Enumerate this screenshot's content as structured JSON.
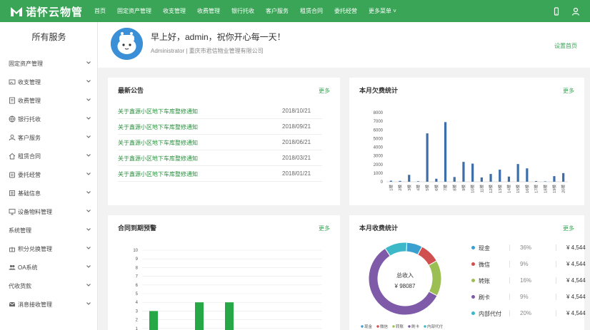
{
  "app": {
    "logo_text": "诺怀云物管"
  },
  "topnav": [
    "首页",
    "固定资产管理",
    "收支管理",
    "收费管理",
    "银行托收",
    "客户服务",
    "租赁合同",
    "委托经营",
    "更多菜单"
  ],
  "sidebar": {
    "title": "所有服务",
    "items": [
      {
        "label": "固定资产管理",
        "icon": "none"
      },
      {
        "label": "收支管理",
        "icon": "image-icon"
      },
      {
        "label": "收费管理",
        "icon": "invoice-icon"
      },
      {
        "label": "银行托收",
        "icon": "globe-icon"
      },
      {
        "label": "客户服务",
        "icon": "user-icon"
      },
      {
        "label": "租赁合同",
        "icon": "home-icon"
      },
      {
        "label": "委托经营",
        "icon": "building-icon"
      },
      {
        "label": "基础信息",
        "icon": "list-icon"
      },
      {
        "label": "设备物料管理",
        "icon": "monitor-icon"
      },
      {
        "label": "系统管理",
        "icon": "none"
      },
      {
        "label": "积分兑换管理",
        "icon": "gift-icon"
      },
      {
        "label": "OA系统",
        "icon": "users-icon"
      },
      {
        "label": "代收货款",
        "icon": "none"
      },
      {
        "label": "消息接收管理",
        "icon": "mail-icon"
      }
    ]
  },
  "welcome": {
    "greeting": "早上好，admin，祝你开心每一天！",
    "role_line": "Administrator | 重庆市君信物业管理有限公司",
    "home_link": "设置首页"
  },
  "notice": {
    "title": "最新公告",
    "more": "更多",
    "rows": [
      {
        "title": "关于鑫源小区地下车库整修通知",
        "date": "2018/10/21"
      },
      {
        "title": "关于鑫源小区地下车库整修通知",
        "date": "2018/09/21"
      },
      {
        "title": "关于鑫源小区地下车库整修通知",
        "date": "2018/06/21"
      },
      {
        "title": "关于鑫源小区地下车库整修通知",
        "date": "2018/03/21"
      },
      {
        "title": "关于鑫源小区地下车库整修通知",
        "date": "2018/01/21"
      }
    ]
  },
  "owe": {
    "title": "本月欠费统计",
    "more": "更多"
  },
  "contract": {
    "title": "合同到期预警",
    "more": "更多"
  },
  "income": {
    "title": "本月收费统计",
    "more": "更多",
    "center_label": "总收入",
    "center_value": "¥ 98087",
    "legend": [
      {
        "name": "现金",
        "pct": "36%",
        "amount": "¥ 4,544",
        "color": "#3b9fd0"
      },
      {
        "name": "微信",
        "pct": "9%",
        "amount": "¥ 4,544",
        "color": "#d0504f"
      },
      {
        "name": "转账",
        "pct": "16%",
        "amount": "¥ 4,544",
        "color": "#9bbf52"
      },
      {
        "name": "刷卡",
        "pct": "9%",
        "amount": "¥ 4,544",
        "color": "#7e5aa8"
      },
      {
        "name": "内部代付",
        "pct": "20%",
        "amount": "¥ 4,544",
        "color": "#3cb8c9"
      }
    ],
    "bottom_legend": [
      "现金",
      "微信",
      "转账",
      "刷卡",
      "内部代付"
    ]
  },
  "chart_data": [
    {
      "type": "bar",
      "title": "本月欠费统计",
      "categories": [
        "1楼",
        "2楼",
        "3楼",
        "4楼",
        "5楼",
        "6楼",
        "7楼",
        "8楼",
        "9楼",
        "10楼",
        "11楼",
        "12楼",
        "13楼",
        "14楼",
        "15楼",
        "16楼",
        "17楼",
        "18楼",
        "19楼",
        "20楼"
      ],
      "values": [
        120,
        100,
        800,
        60,
        5600,
        350,
        6900,
        550,
        2300,
        2100,
        500,
        900,
        1400,
        600,
        2050,
        1550,
        80,
        50,
        650,
        1000
      ],
      "ylim": [
        0,
        8000
      ],
      "yticks": [
        0,
        1000,
        2000,
        3000,
        4000,
        5000,
        6000,
        7000,
        8000
      ],
      "color": "#3e6ea8"
    },
    {
      "type": "bar",
      "title": "合同到期预警",
      "values": [
        3,
        4,
        4
      ],
      "ylim": [
        0,
        10
      ],
      "yticks": [
        1,
        2,
        3,
        4,
        5,
        6,
        7,
        8,
        9,
        10
      ],
      "color": "#27a846"
    },
    {
      "type": "pie",
      "title": "本月收费统计",
      "slices": [
        {
          "name": "现金",
          "value": 7,
          "color": "#3b9fd0"
        },
        {
          "name": "微信",
          "value": 9,
          "color": "#d0504f"
        },
        {
          "name": "转账",
          "value": 16,
          "color": "#9bbf52"
        },
        {
          "name": "刷卡",
          "value": 58,
          "color": "#7e5aa8"
        },
        {
          "name": "内部代付",
          "value": 10,
          "color": "#3cb8c9"
        }
      ]
    }
  ]
}
